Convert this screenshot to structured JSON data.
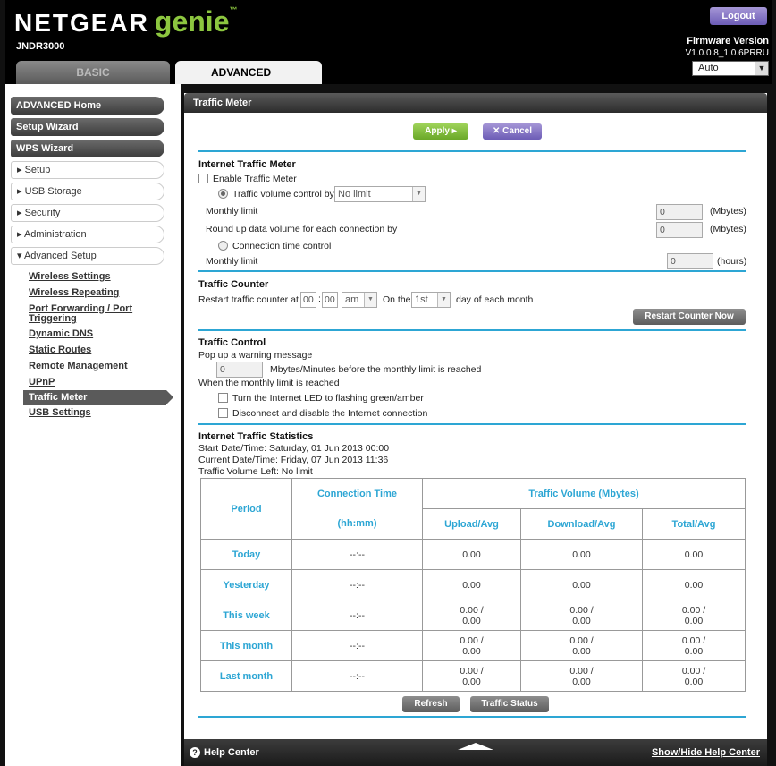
{
  "header": {
    "brand_main": "NETGEAR",
    "brand_genie": "genie",
    "brand_tm": "™",
    "model": "JNDR3000",
    "logout": "Logout",
    "firmware_label": "Firmware Version",
    "firmware_value": "V1.0.0.8_1.0.6PRRU",
    "language": "Auto",
    "tabs": {
      "basic": "BASIC",
      "advanced": "ADVANCED"
    }
  },
  "sidebar": {
    "main": [
      "ADVANCED Home",
      "Setup Wizard",
      "WPS Wizard"
    ],
    "groups": [
      "▸ Setup",
      "▸ USB Storage",
      "▸ Security",
      "▸ Administration",
      "▾ Advanced Setup"
    ],
    "sub_items": [
      "Wireless Settings",
      "Wireless Repeating",
      "Port Forwarding / Port Triggering",
      "Dynamic DNS",
      "Static Routes",
      "Remote Management",
      "UPnP",
      "Traffic Meter",
      "USB Settings"
    ]
  },
  "main": {
    "title": "Traffic Meter",
    "apply": "Apply ▸",
    "cancel": "✕ Cancel",
    "itm": {
      "title": "Internet Traffic Meter",
      "enable": "Enable Traffic Meter",
      "volume_control": "Traffic volume control by",
      "volume_select": "No limit",
      "monthly_limit": "Monthly limit",
      "monthly_value": "0",
      "mbytes": "(Mbytes)",
      "roundup": "Round up data volume for each connection by",
      "roundup_value": "0",
      "conn_time": "Connection time control",
      "monthly_limit2": "Monthly limit",
      "hours_value": "0",
      "hours": "(hours)"
    },
    "counter": {
      "title": "Traffic Counter",
      "restart_at": "Restart traffic counter at",
      "hh": "00",
      "mm": "00",
      "ampm": "am",
      "on_the": "On the",
      "day": "1st",
      "day_suffix": "day of each month",
      "restart_now": "Restart Counter Now"
    },
    "control": {
      "title": "Traffic Control",
      "popup": "Pop up a warning message",
      "popup_value": "0",
      "popup_desc": "Mbytes/Minutes before the monthly limit is reached",
      "when": "When the monthly limit is reached",
      "led": "Turn the Internet LED to flashing green/amber",
      "disconnect": "Disconnect and disable the Internet connection"
    },
    "stats": {
      "title": "Internet Traffic Statistics",
      "start": "Start Date/Time: Saturday, 01 Jun 2013 00:00",
      "current": "Current Date/Time: Friday, 07 Jun 2013 11:36",
      "left": "Traffic Volume Left: No limit",
      "headers": {
        "period": "Period",
        "conn_time": "Connection Time",
        "volume": "Traffic Volume (Mbytes)",
        "hhmm": "(hh:mm)",
        "upload": "Upload/Avg",
        "download": "Download/Avg",
        "total": "Total/Avg"
      },
      "rows": [
        {
          "period": "Today",
          "time": "--:--",
          "up": "0.00",
          "down": "0.00",
          "total": "0.00"
        },
        {
          "period": "Yesterday",
          "time": "--:--",
          "up": "0.00",
          "down": "0.00",
          "total": "0.00"
        },
        {
          "period": "This week",
          "time": "--:--",
          "up": "0.00 /\n0.00",
          "down": "0.00 /\n0.00",
          "total": "0.00 /\n0.00"
        },
        {
          "period": "This month",
          "time": "--:--",
          "up": "0.00 /\n0.00",
          "down": "0.00 /\n0.00",
          "total": "0.00 /\n0.00"
        },
        {
          "period": "Last month",
          "time": "--:--",
          "up": "0.00 /\n0.00",
          "down": "0.00 /\n0.00",
          "total": "0.00 /\n0.00"
        }
      ]
    },
    "refresh": "Refresh",
    "traffic_status": "Traffic Status",
    "help_center": "Help Center",
    "help_toggle": "Show/Hide Help Center"
  },
  "colors": {
    "accent_blue": "#2da6d4",
    "green": "#8cc63f",
    "purple": "#6c5cb6"
  },
  "icons": [
    "question-icon",
    "dropdown-arrow-icon",
    "triangle-up-icon"
  ]
}
